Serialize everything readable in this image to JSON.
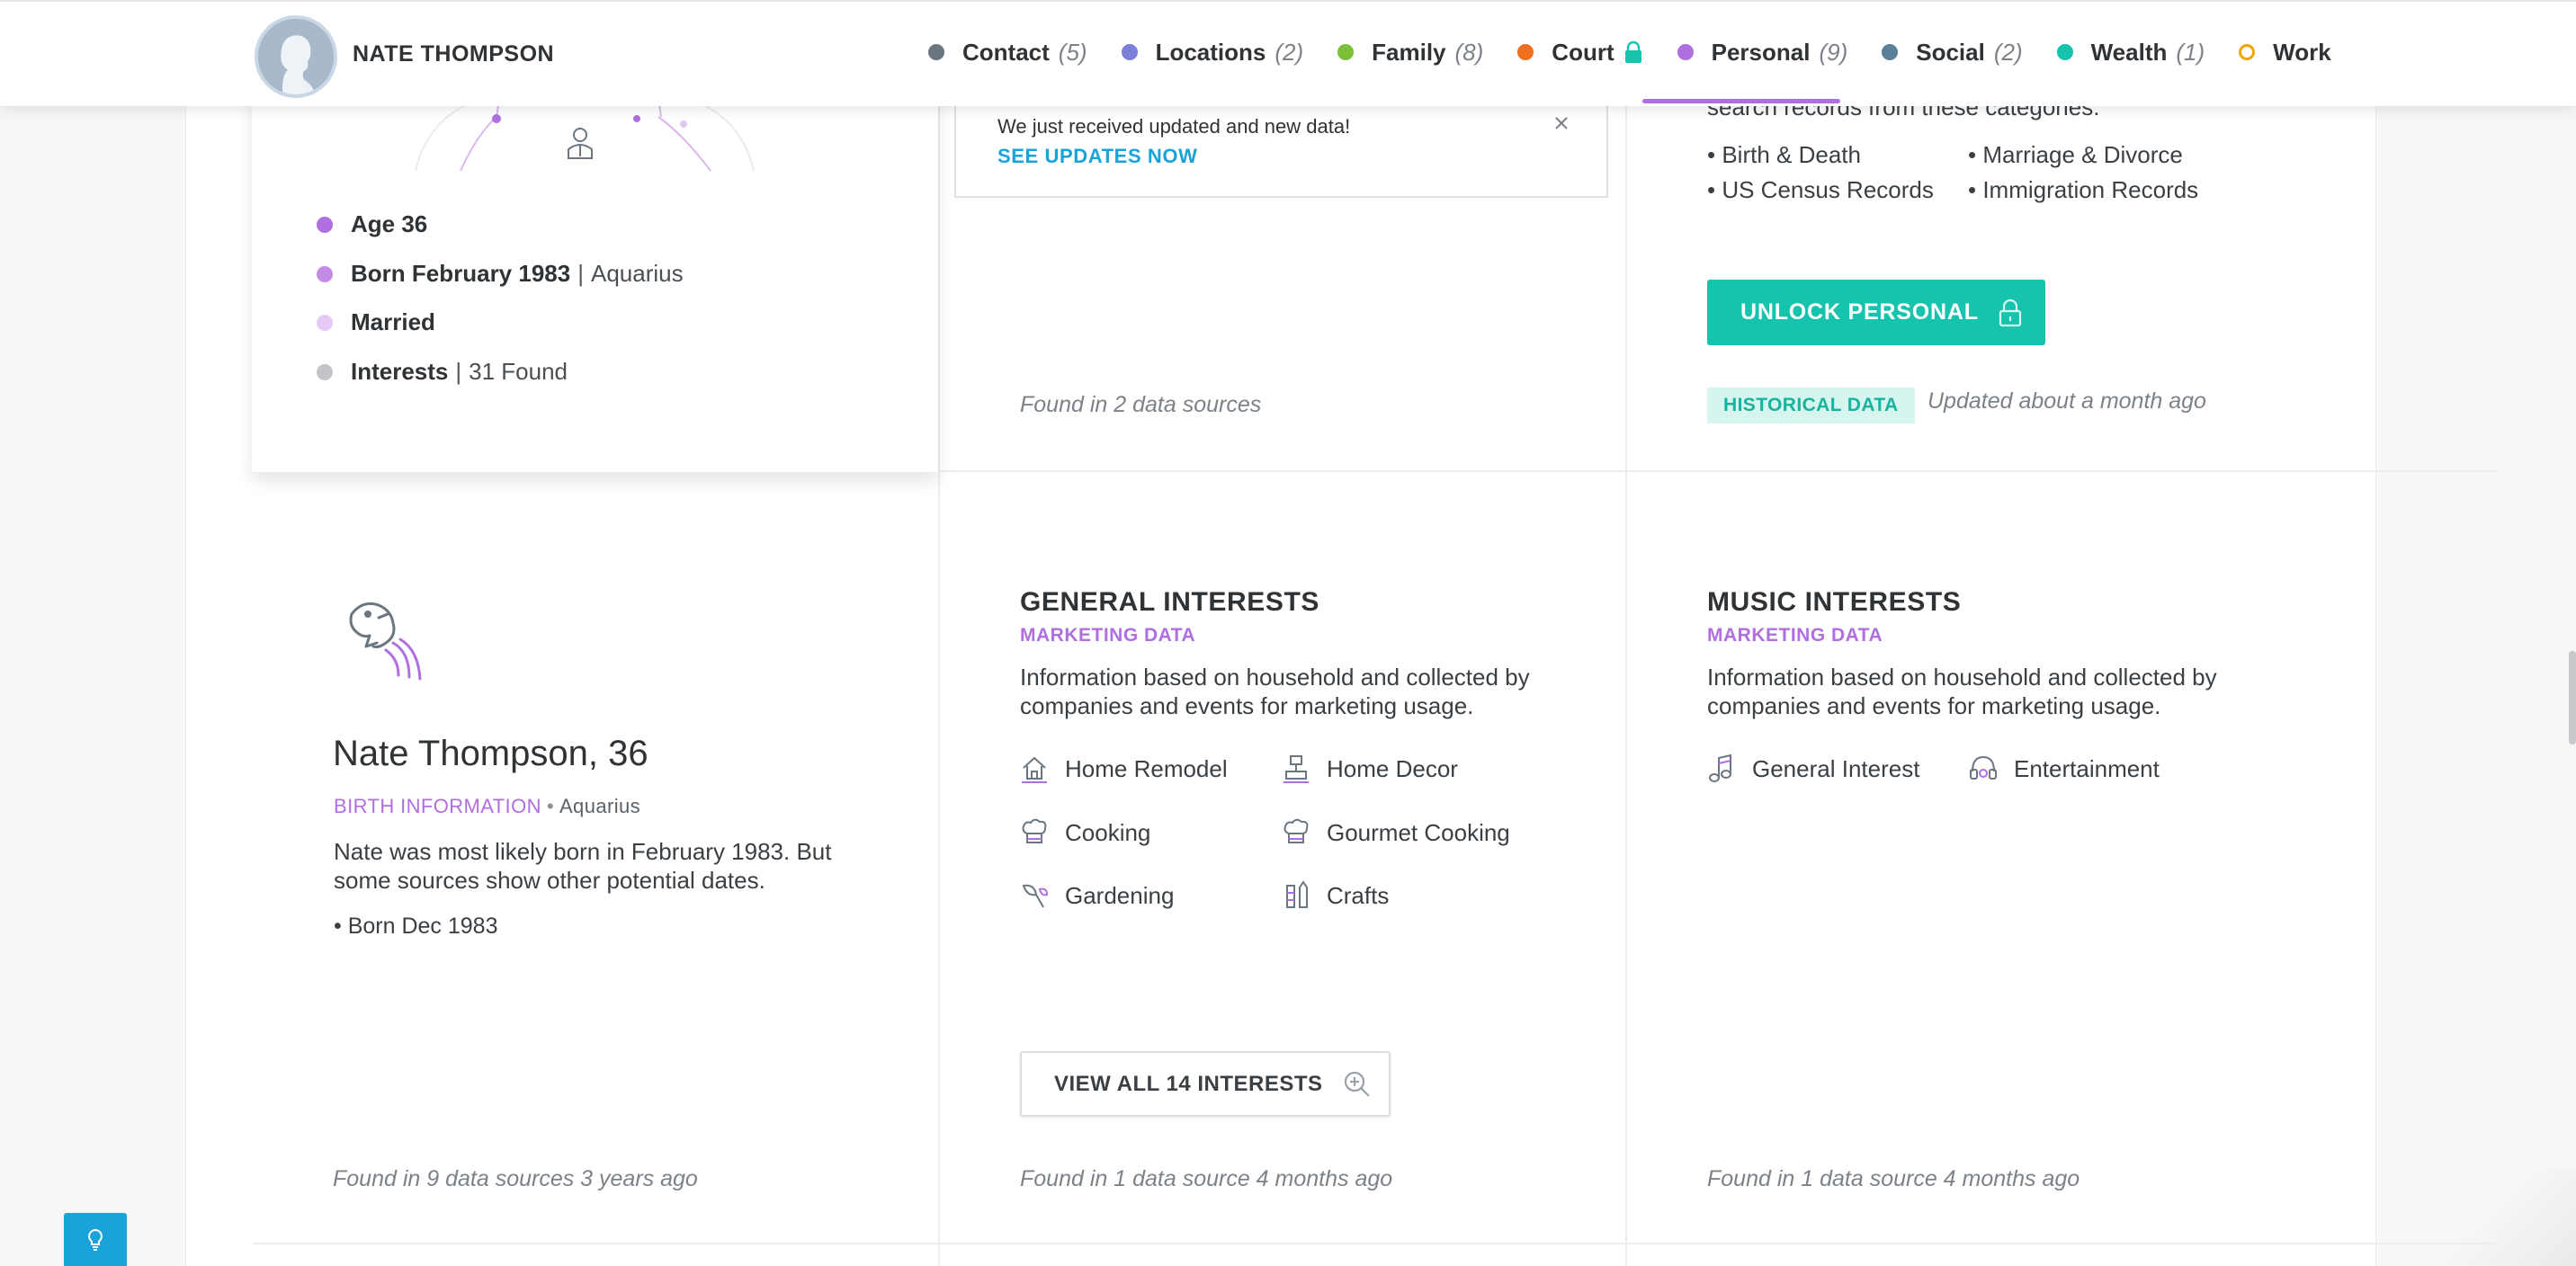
{
  "header": {
    "person_name": "NATE THOMPSON",
    "nav": [
      {
        "label": "Contact",
        "count": "(5)",
        "color": "#6b7680"
      },
      {
        "label": "Locations",
        "count": "(2)",
        "color": "#7b7fd8"
      },
      {
        "label": "Family",
        "count": "(8)",
        "color": "#7cc13a"
      },
      {
        "label": "Court",
        "count": "",
        "color": "#f07020",
        "locked": true
      },
      {
        "label": "Personal",
        "count": "(9)",
        "color": "#b06fe0",
        "active": true
      },
      {
        "label": "Social",
        "count": "(2)",
        "color": "#5a7f96"
      },
      {
        "label": "Wealth",
        "count": "(1)",
        "color": "#16c3ad"
      },
      {
        "label": "Work",
        "count": "",
        "color": "#f0a500",
        "hollow": true
      }
    ]
  },
  "notice": {
    "message": "We just received updated and new data!",
    "link": "SEE UPDATES NOW"
  },
  "profile": {
    "facts": [
      {
        "bold": "Age 36",
        "rest": "",
        "color": "#b06fe0"
      },
      {
        "bold": "Born February 1983",
        "rest": "Aquarius",
        "color": "#c28be6"
      },
      {
        "bold": "Married",
        "rest": "",
        "color": "#e5c8f5"
      },
      {
        "bold": "Interests",
        "rest": "31 Found",
        "color": "#c4c4c8"
      }
    ],
    "found": "Found in 2 data sources"
  },
  "personal": {
    "intro_tail": "search records from these categories:",
    "records": [
      "Birth & Death",
      "Marriage & Divorce",
      "US Census Records",
      "Immigration Records"
    ],
    "unlock_label": "UNLOCK PERSONAL",
    "badge": "HISTORICAL DATA",
    "updated": "Updated about a month ago"
  },
  "birth": {
    "name": "Nate Thompson, 36",
    "label": "BIRTH INFORMATION",
    "sign": "Aquarius",
    "description": "Nate was most likely born in February 1983. But some sources show other potential dates.",
    "alt_date": "• Born Dec 1983",
    "found": "Found in 9 data sources 3 years ago"
  },
  "general_interests": {
    "title": "GENERAL INTERESTS",
    "subtitle": "MARKETING DATA",
    "description": "Information based on household and collected by companies and events for marketing usage.",
    "items": [
      "Home Remodel",
      "Home Decor",
      "Cooking",
      "Gourmet Cooking",
      "Gardening",
      "Crafts"
    ],
    "view_all": "VIEW ALL 14 INTERESTS",
    "found": "Found in 1 data source 4 months ago"
  },
  "music_interests": {
    "title": "MUSIC INTERESTS",
    "subtitle": "MARKETING DATA",
    "description": "Information based on household and collected by companies and events for marketing usage.",
    "items": [
      "General Interest",
      "Entertainment"
    ],
    "found": "Found in 1 data source 4 months ago"
  }
}
